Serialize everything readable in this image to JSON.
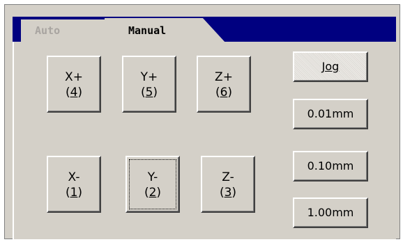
{
  "tabs": [
    {
      "label": "Auto",
      "active": false
    },
    {
      "label": "Manual",
      "active": true
    }
  ],
  "axis_buttons": {
    "x_plus": {
      "axis": "X+",
      "key": "4"
    },
    "y_plus": {
      "axis": "Y+",
      "key": "5"
    },
    "z_plus": {
      "axis": "Z+",
      "key": "6"
    },
    "x_minus": {
      "axis": "X-",
      "key": "1"
    },
    "y_minus": {
      "axis": "Y-",
      "key": "2"
    },
    "z_minus": {
      "axis": "Z-",
      "key": "3"
    }
  },
  "step_buttons": {
    "jog": "Jog",
    "s001": "0.01mm",
    "s010": "0.10mm",
    "s100": "1.00mm"
  },
  "colors": {
    "tabstrip": "#000080",
    "face": "#d4d0c8"
  }
}
